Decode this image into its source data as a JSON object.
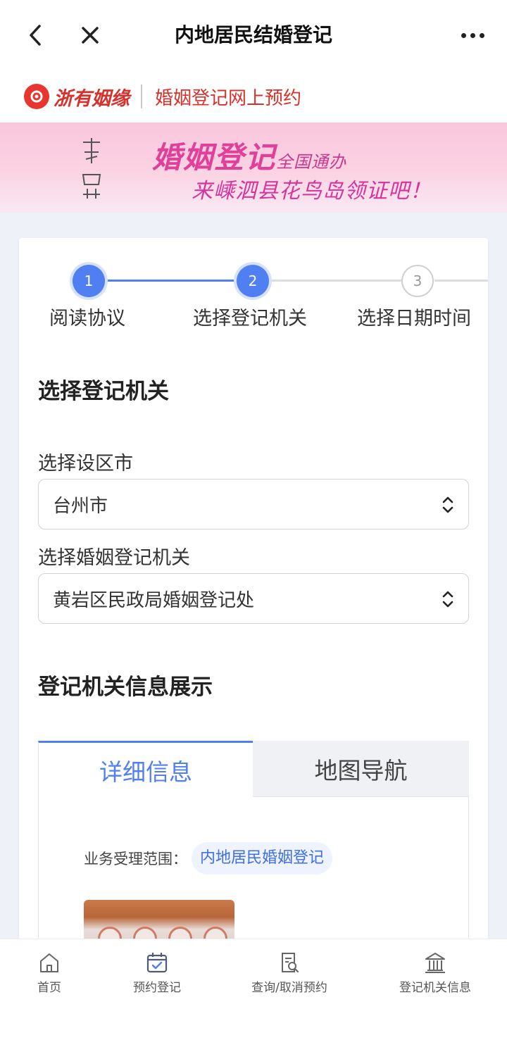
{
  "topbar": {
    "title": "内地居民结婚登记"
  },
  "brand": {
    "name": "浙有姻缘",
    "subtitle": "婚姻登记网上预约"
  },
  "banner": {
    "line1": "婚姻登记",
    "line1_suffix": "全国通办",
    "line2": "来嵊泗县花鸟岛领证吧！"
  },
  "steps": [
    {
      "number": "1",
      "label": "阅读协议",
      "state": "done"
    },
    {
      "number": "2",
      "label": "选择登记机关",
      "state": "current"
    },
    {
      "number": "3",
      "label": "选择日期时间",
      "state": "todo"
    }
  ],
  "form": {
    "section_title": "选择登记机关",
    "city_label": "选择设区市",
    "city_value": "台州市",
    "office_label": "选择婚姻登记机关",
    "office_value": "黄岩区民政局婚姻登记处"
  },
  "info": {
    "section_title": "登记机关信息展示",
    "tabs": [
      {
        "label": "详细信息",
        "active": true
      },
      {
        "label": "地图导航",
        "active": false
      }
    ],
    "scope_label": "业务受理范围：",
    "scope_value": "内地居民婚姻登记"
  },
  "bottom_nav": [
    {
      "label": "首页",
      "icon": "home-icon"
    },
    {
      "label": "预约登记",
      "icon": "calendar-check-icon"
    },
    {
      "label": "查询/取消预约",
      "icon": "document-search-icon"
    },
    {
      "label": "登记机关信息",
      "icon": "building-icon"
    }
  ],
  "colors": {
    "primary": "#4f7ff0",
    "brand_red": "#d8302a",
    "banner_pink": "#e0409a"
  }
}
